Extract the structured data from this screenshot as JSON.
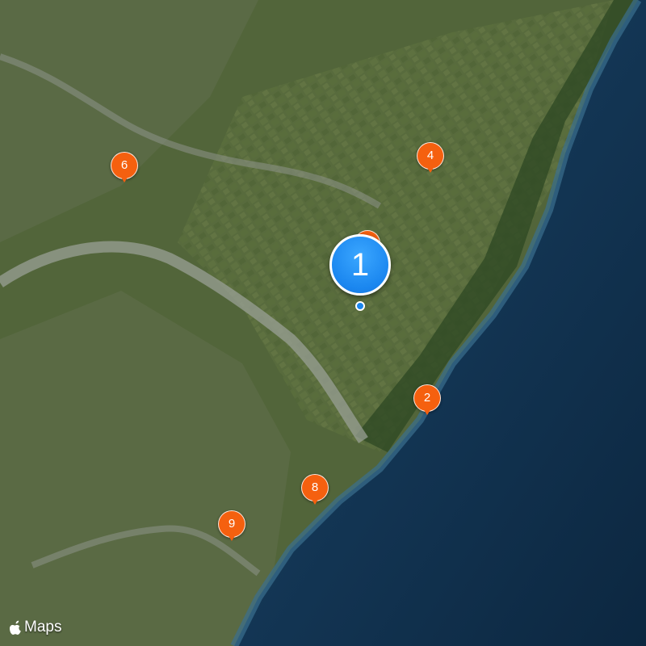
{
  "map": {
    "type": "satellite",
    "pins": [
      {
        "id": "pin-1",
        "label": "1",
        "style": "primary"
      },
      {
        "id": "pin-2",
        "label": "2",
        "style": "cluster"
      },
      {
        "id": "pin-4",
        "label": "4",
        "style": "cluster"
      },
      {
        "id": "pin-6",
        "label": "6",
        "style": "cluster"
      },
      {
        "id": "pin-8",
        "label": "8",
        "style": "cluster"
      },
      {
        "id": "pin-9",
        "label": "9",
        "style": "cluster"
      }
    ],
    "colors": {
      "primary_pin": "#1a86ef",
      "cluster_pin": "#f5600f",
      "sea": "#10304e",
      "land": "#4f6236"
    }
  },
  "attribution": {
    "icon": "apple-logo-icon",
    "text": "Maps"
  }
}
